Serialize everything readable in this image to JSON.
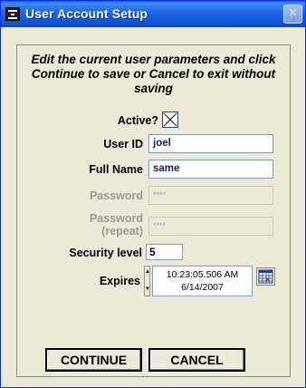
{
  "window": {
    "title": "User Account Setup",
    "close_glyph": "×",
    "app_icon": "app-window-icon"
  },
  "instruction": {
    "line1": "Edit the current user parameters and click",
    "line2": "Continue to save or Cancel to exit without",
    "line3": "saving"
  },
  "form": {
    "active_label": "Active?",
    "active_checked": true,
    "user_id_label": "User ID",
    "user_id_value": "joel",
    "full_name_label": "Full Name",
    "full_name_value": "same",
    "password_label": "Password",
    "password_value": "****",
    "password_repeat_label_1": "Password",
    "password_repeat_label_2": "(repeat)",
    "password_repeat_value": "****",
    "security_level_label": "Security level",
    "security_level_value": "5",
    "expires_label": "Expires",
    "expires_time": "10:23:05.506 AM",
    "expires_date": "6/14/2007"
  },
  "buttons": {
    "continue_label": "CONTINUE",
    "cancel_label": "CANCEL"
  },
  "colors": {
    "titlebar": "#0b52d6",
    "window_bg": "#ece9d8",
    "field_border": "#7f9db9",
    "disabled_text": "#9c9a8c"
  }
}
